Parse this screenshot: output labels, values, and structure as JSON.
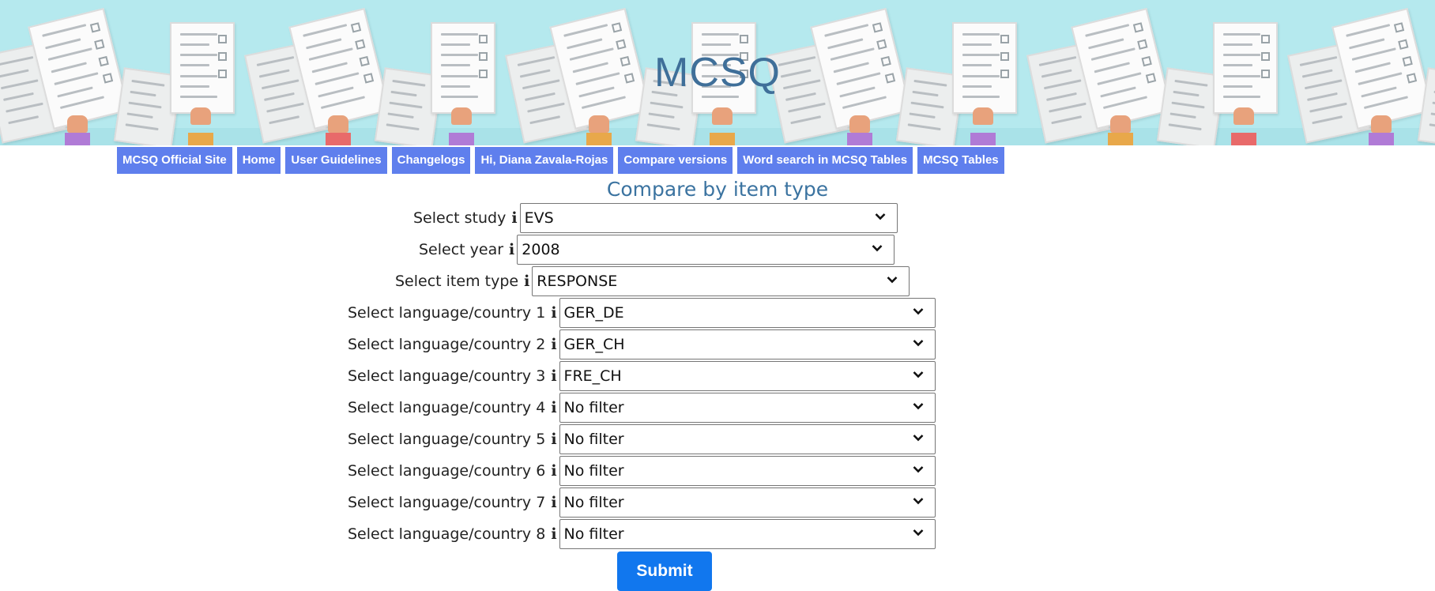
{
  "banner": {
    "title": "MCSQ"
  },
  "nav": [
    {
      "label": "MCSQ Official Site"
    },
    {
      "label": "Home"
    },
    {
      "label": "User Guidelines"
    },
    {
      "label": "Changelogs"
    },
    {
      "label": "Hi, Diana Zavala-Rojas"
    },
    {
      "label": "Compare versions"
    },
    {
      "label": "Word search in MCSQ Tables"
    },
    {
      "label": "MCSQ Tables"
    }
  ],
  "form": {
    "heading": "Compare by item type",
    "info_glyph": "i",
    "fields": [
      {
        "label": "Select study",
        "value": "EVS"
      },
      {
        "label": "Select year",
        "value": "2008"
      },
      {
        "label": "Select item type",
        "value": "RESPONSE"
      },
      {
        "label": "Select language/country 1",
        "value": "GER_DE"
      },
      {
        "label": "Select language/country 2",
        "value": "GER_CH"
      },
      {
        "label": "Select language/country 3",
        "value": "FRE_CH"
      },
      {
        "label": "Select language/country 4",
        "value": "No filter"
      },
      {
        "label": "Select language/country 5",
        "value": "No filter"
      },
      {
        "label": "Select language/country 6",
        "value": "No filter"
      },
      {
        "label": "Select language/country 7",
        "value": "No filter"
      },
      {
        "label": "Select language/country 8",
        "value": "No filter"
      }
    ],
    "submit_label": "Submit"
  },
  "colors": {
    "banner_bg": "#b5e9ee",
    "nav_bg": "#5f7fed",
    "heading": "#3b73a0",
    "submit_bg": "#1177ee"
  },
  "icons": {
    "info": "info-icon",
    "dropdown": "chevron-down-icon"
  }
}
